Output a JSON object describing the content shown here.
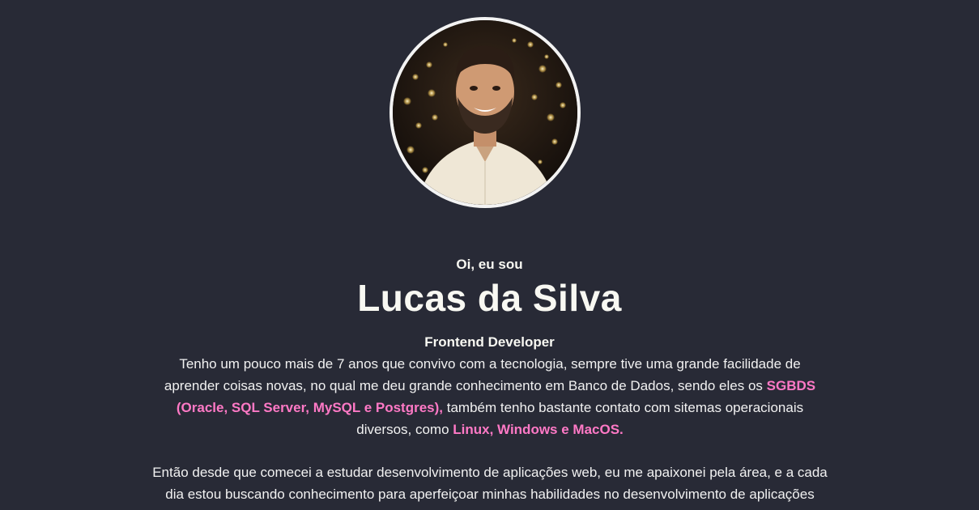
{
  "profile": {
    "photo_icon": "person-portrait-photo",
    "greeting": "Oi, eu sou",
    "name": "Lucas da Silva",
    "role": "Frontend Developer"
  },
  "bio": {
    "p1_text_1": "Tenho um pouco mais de 7 anos que convivo com a tecnologia, sempre tive uma grande facilidade de aprender coisas novas, no qual me deu grande conhecimento em Banco de Dados, sendo eles os ",
    "p1_highlight_1": "SGBDS (Oracle, SQL Server, MySQL e Postgres),",
    "p1_text_2": " também tenho bastante contato com sitemas operacionais diversos, como ",
    "p1_highlight_2": "Linux, Windows e MacOS.",
    "p2_text": "Então desde que comecei a estudar desenvolvimento de aplicações web, eu me apaixonei pela área, e a cada dia estou buscando conhecimento para aperfeiçoar minhas habilidades no desenvolvimento de aplicações"
  },
  "colors": {
    "background": "#282a36",
    "accent": "#ff79c6",
    "text": "#f8f8f2"
  }
}
